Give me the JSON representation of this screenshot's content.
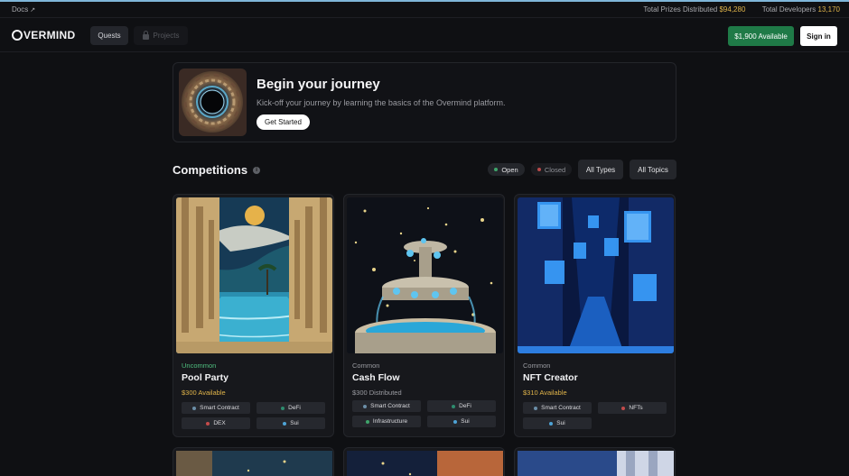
{
  "topbar": {
    "docs_label": "Docs",
    "docs_arrow": "↗",
    "prizes_label": "Total Prizes Distributed",
    "prizes_value": "$94,280",
    "developers_label": "Total Developers",
    "developers_value": "13,170"
  },
  "nav": {
    "brand": "VERMIND",
    "tabs": [
      {
        "label": "Quests",
        "active": true
      },
      {
        "label": "Projects",
        "locked": true
      }
    ],
    "available_button": "$1,900 Available",
    "signin_button": "Sign in"
  },
  "journey": {
    "title": "Begin your journey",
    "description": "Kick-off your journey by learning the basics of the Overmind platform.",
    "cta": "Get Started"
  },
  "competitions": {
    "title": "Competitions",
    "info_icon": "info-icon",
    "filters": {
      "open": {
        "label": "Open",
        "color": "#3fa56b"
      },
      "closed": {
        "label": "Closed",
        "color": "#b84a4a"
      },
      "types": "All Types",
      "topics": "All Topics"
    },
    "cards": [
      {
        "rarity": "Uncommon",
        "rarity_color": "#4fbf7f",
        "name": "Pool Party",
        "prize": "$300 Available",
        "prize_color": "#e0b44a",
        "tags": [
          {
            "label": "Smart Contract",
            "color": "#6b8fa8"
          },
          {
            "label": "DeFi",
            "color": "#2e8c6e"
          },
          {
            "label": "DEX",
            "color": "#c44b4b"
          },
          {
            "label": "Sui",
            "color": "#4ea3d6"
          }
        ]
      },
      {
        "rarity": "Common",
        "rarity_color": "#9a9ba1",
        "name": "Cash Flow",
        "prize": "$300 Distributed",
        "prize_color": "#9a9ba1",
        "tags": [
          {
            "label": "Smart Contract",
            "color": "#6b8fa8"
          },
          {
            "label": "DeFi",
            "color": "#2e8c6e"
          },
          {
            "label": "Infrastructure",
            "color": "#3fa56b"
          },
          {
            "label": "Sui",
            "color": "#4ea3d6"
          }
        ]
      },
      {
        "rarity": "Common",
        "rarity_color": "#9a9ba1",
        "name": "NFT Creator",
        "prize": "$310 Available",
        "prize_color": "#e0b44a",
        "tags": [
          {
            "label": "Smart Contract",
            "color": "#6b8fa8"
          },
          {
            "label": "NFTs",
            "color": "#c44b4b"
          },
          {
            "label": "Sui",
            "color": "#4ea3d6"
          }
        ]
      }
    ]
  }
}
